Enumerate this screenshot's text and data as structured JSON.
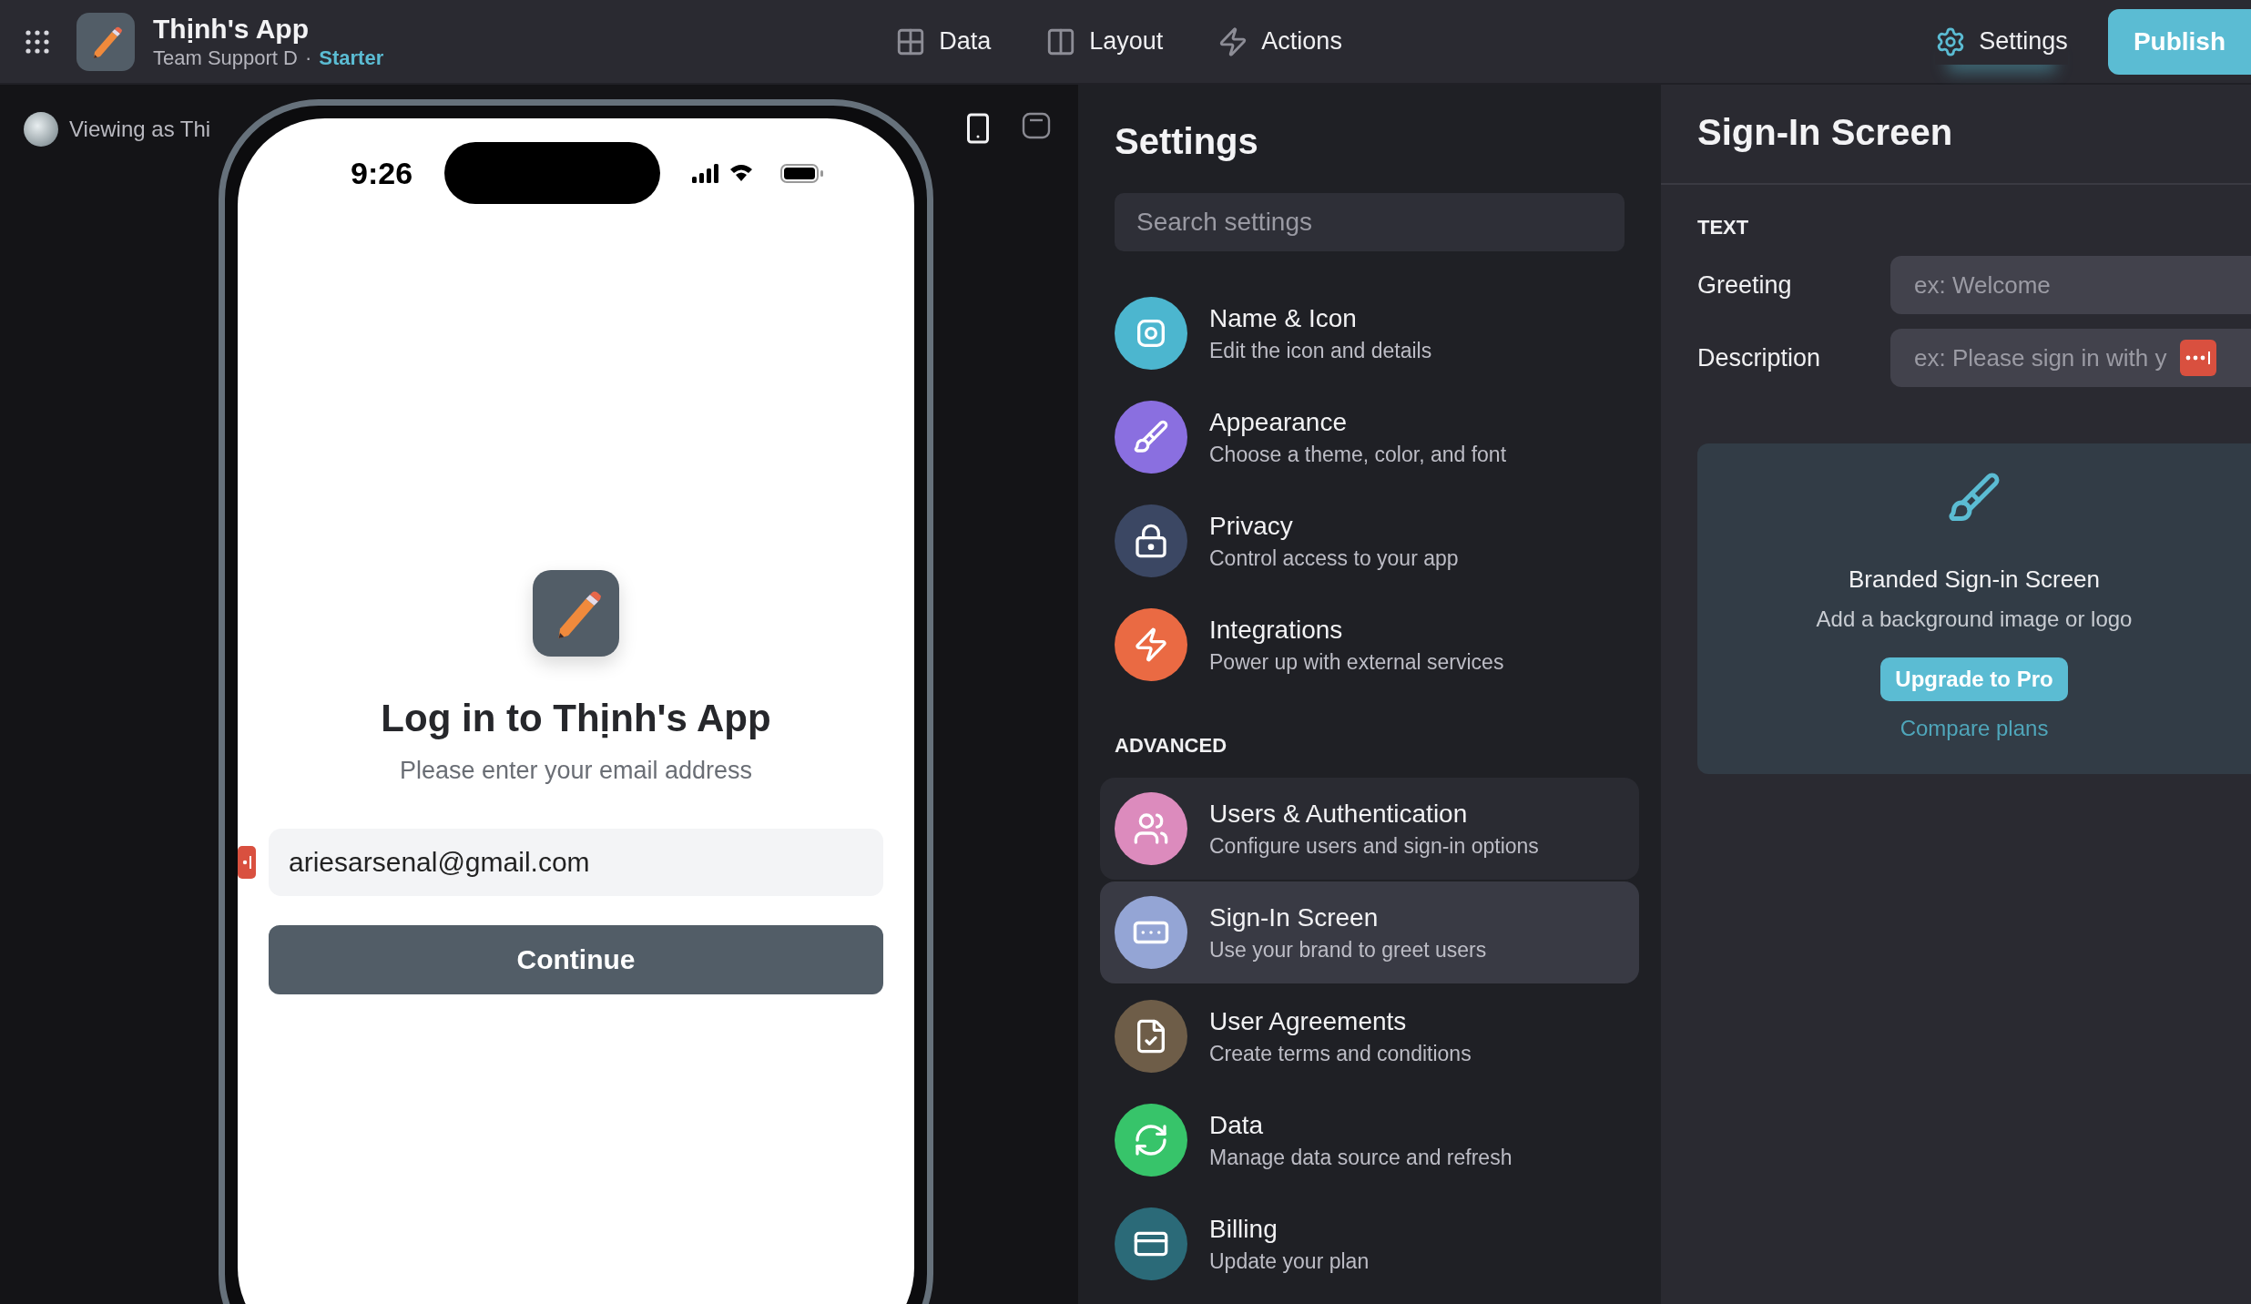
{
  "topbar": {
    "app_name": "Thịnh's App",
    "team": "Team Support D",
    "separator": "·",
    "plan": "Starter",
    "nav": [
      {
        "label": "Data",
        "selected": false
      },
      {
        "label": "Layout",
        "selected": false
      },
      {
        "label": "Actions",
        "selected": false
      }
    ],
    "settings_tab": {
      "label": "Settings",
      "selected": true
    },
    "publish": "Publish"
  },
  "canvas": {
    "viewing_as": "Viewing as Thi",
    "devices": [
      {
        "selected": true
      },
      {
        "selected": false
      }
    ],
    "phone": {
      "time": "9:26",
      "title": "Log in to Thịnh's App",
      "subtitle": "Please enter your email address",
      "email": "ariesarsenal@gmail.com",
      "button": "Continue"
    }
  },
  "settings": {
    "title": "Settings",
    "search_placeholder": "Search settings",
    "groups": [
      {
        "items": [
          {
            "title": "Name & Icon",
            "description": "Edit the icon and details",
            "color": "#4cb6cf",
            "selected": false,
            "hovered": false
          },
          {
            "title": "Appearance",
            "description": "Choose a theme, color, and font",
            "color": "#8a6fe0",
            "selected": false,
            "hovered": false
          },
          {
            "title": "Privacy",
            "description": "Control access to your app",
            "color": "#3b4763",
            "selected": false,
            "hovered": false
          },
          {
            "title": "Integrations",
            "description": "Power up with external services",
            "color": "#ea6a43",
            "selected": false,
            "hovered": false
          }
        ]
      },
      {
        "heading": "ADVANCED",
        "items": [
          {
            "title": "Users & Authentication",
            "description": "Configure users and sign-in options",
            "color": "#dc8bbd",
            "selected": false,
            "hovered": true
          },
          {
            "title": "Sign-In Screen",
            "description": "Use your brand to greet users",
            "color": "#94a5d5",
            "selected": true,
            "hovered": false
          },
          {
            "title": "User Agreements",
            "description": "Create terms and conditions",
            "color": "#6e5d48",
            "selected": false,
            "hovered": false
          },
          {
            "title": "Data",
            "description": "Manage data source and refresh",
            "color": "#37c46a",
            "selected": false,
            "hovered": false
          },
          {
            "title": "Billing",
            "description": "Update your plan",
            "color": "#2b6a78",
            "selected": false,
            "hovered": false
          }
        ]
      }
    ]
  },
  "detail": {
    "title": "Sign-In Screen",
    "section": "TEXT",
    "fields": [
      {
        "label": "Greeting",
        "placeholder": "ex: Welcome"
      },
      {
        "label": "Description",
        "placeholder": "ex: Please sign in with y"
      }
    ],
    "promo": {
      "title": "Branded Sign-in Screen",
      "subtitle": "Add a background image or logo",
      "button": "Upgrade to Pro",
      "link": "Compare plans"
    }
  }
}
